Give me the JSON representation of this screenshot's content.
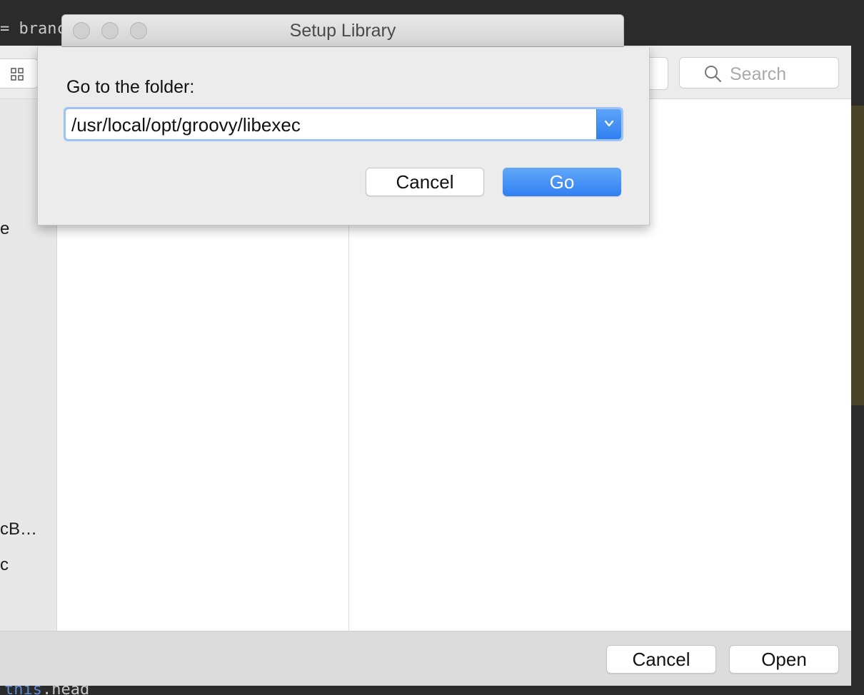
{
  "editor": {
    "code_top": "= branc",
    "code_bottom_keyword": "this",
    "code_bottom_rest": ".head"
  },
  "open_panel": {
    "search_placeholder": "Search",
    "sidebar_items": [
      "e",
      "cB…",
      "c"
    ],
    "footer": {
      "cancel_label": "Cancel",
      "open_label": "Open"
    }
  },
  "window": {
    "title": "Setup Library"
  },
  "go_to_folder": {
    "label": "Go to the folder:",
    "path_value": "/usr/local/opt/groovy/libexec",
    "cancel_label": "Cancel",
    "go_label": "Go"
  },
  "colors": {
    "accent": "#2f80f2",
    "focus_ring": "#9ec2f3"
  },
  "icons": {
    "view": "grid-icon",
    "search": "search-icon",
    "dropdown": "chevron-down-icon"
  }
}
